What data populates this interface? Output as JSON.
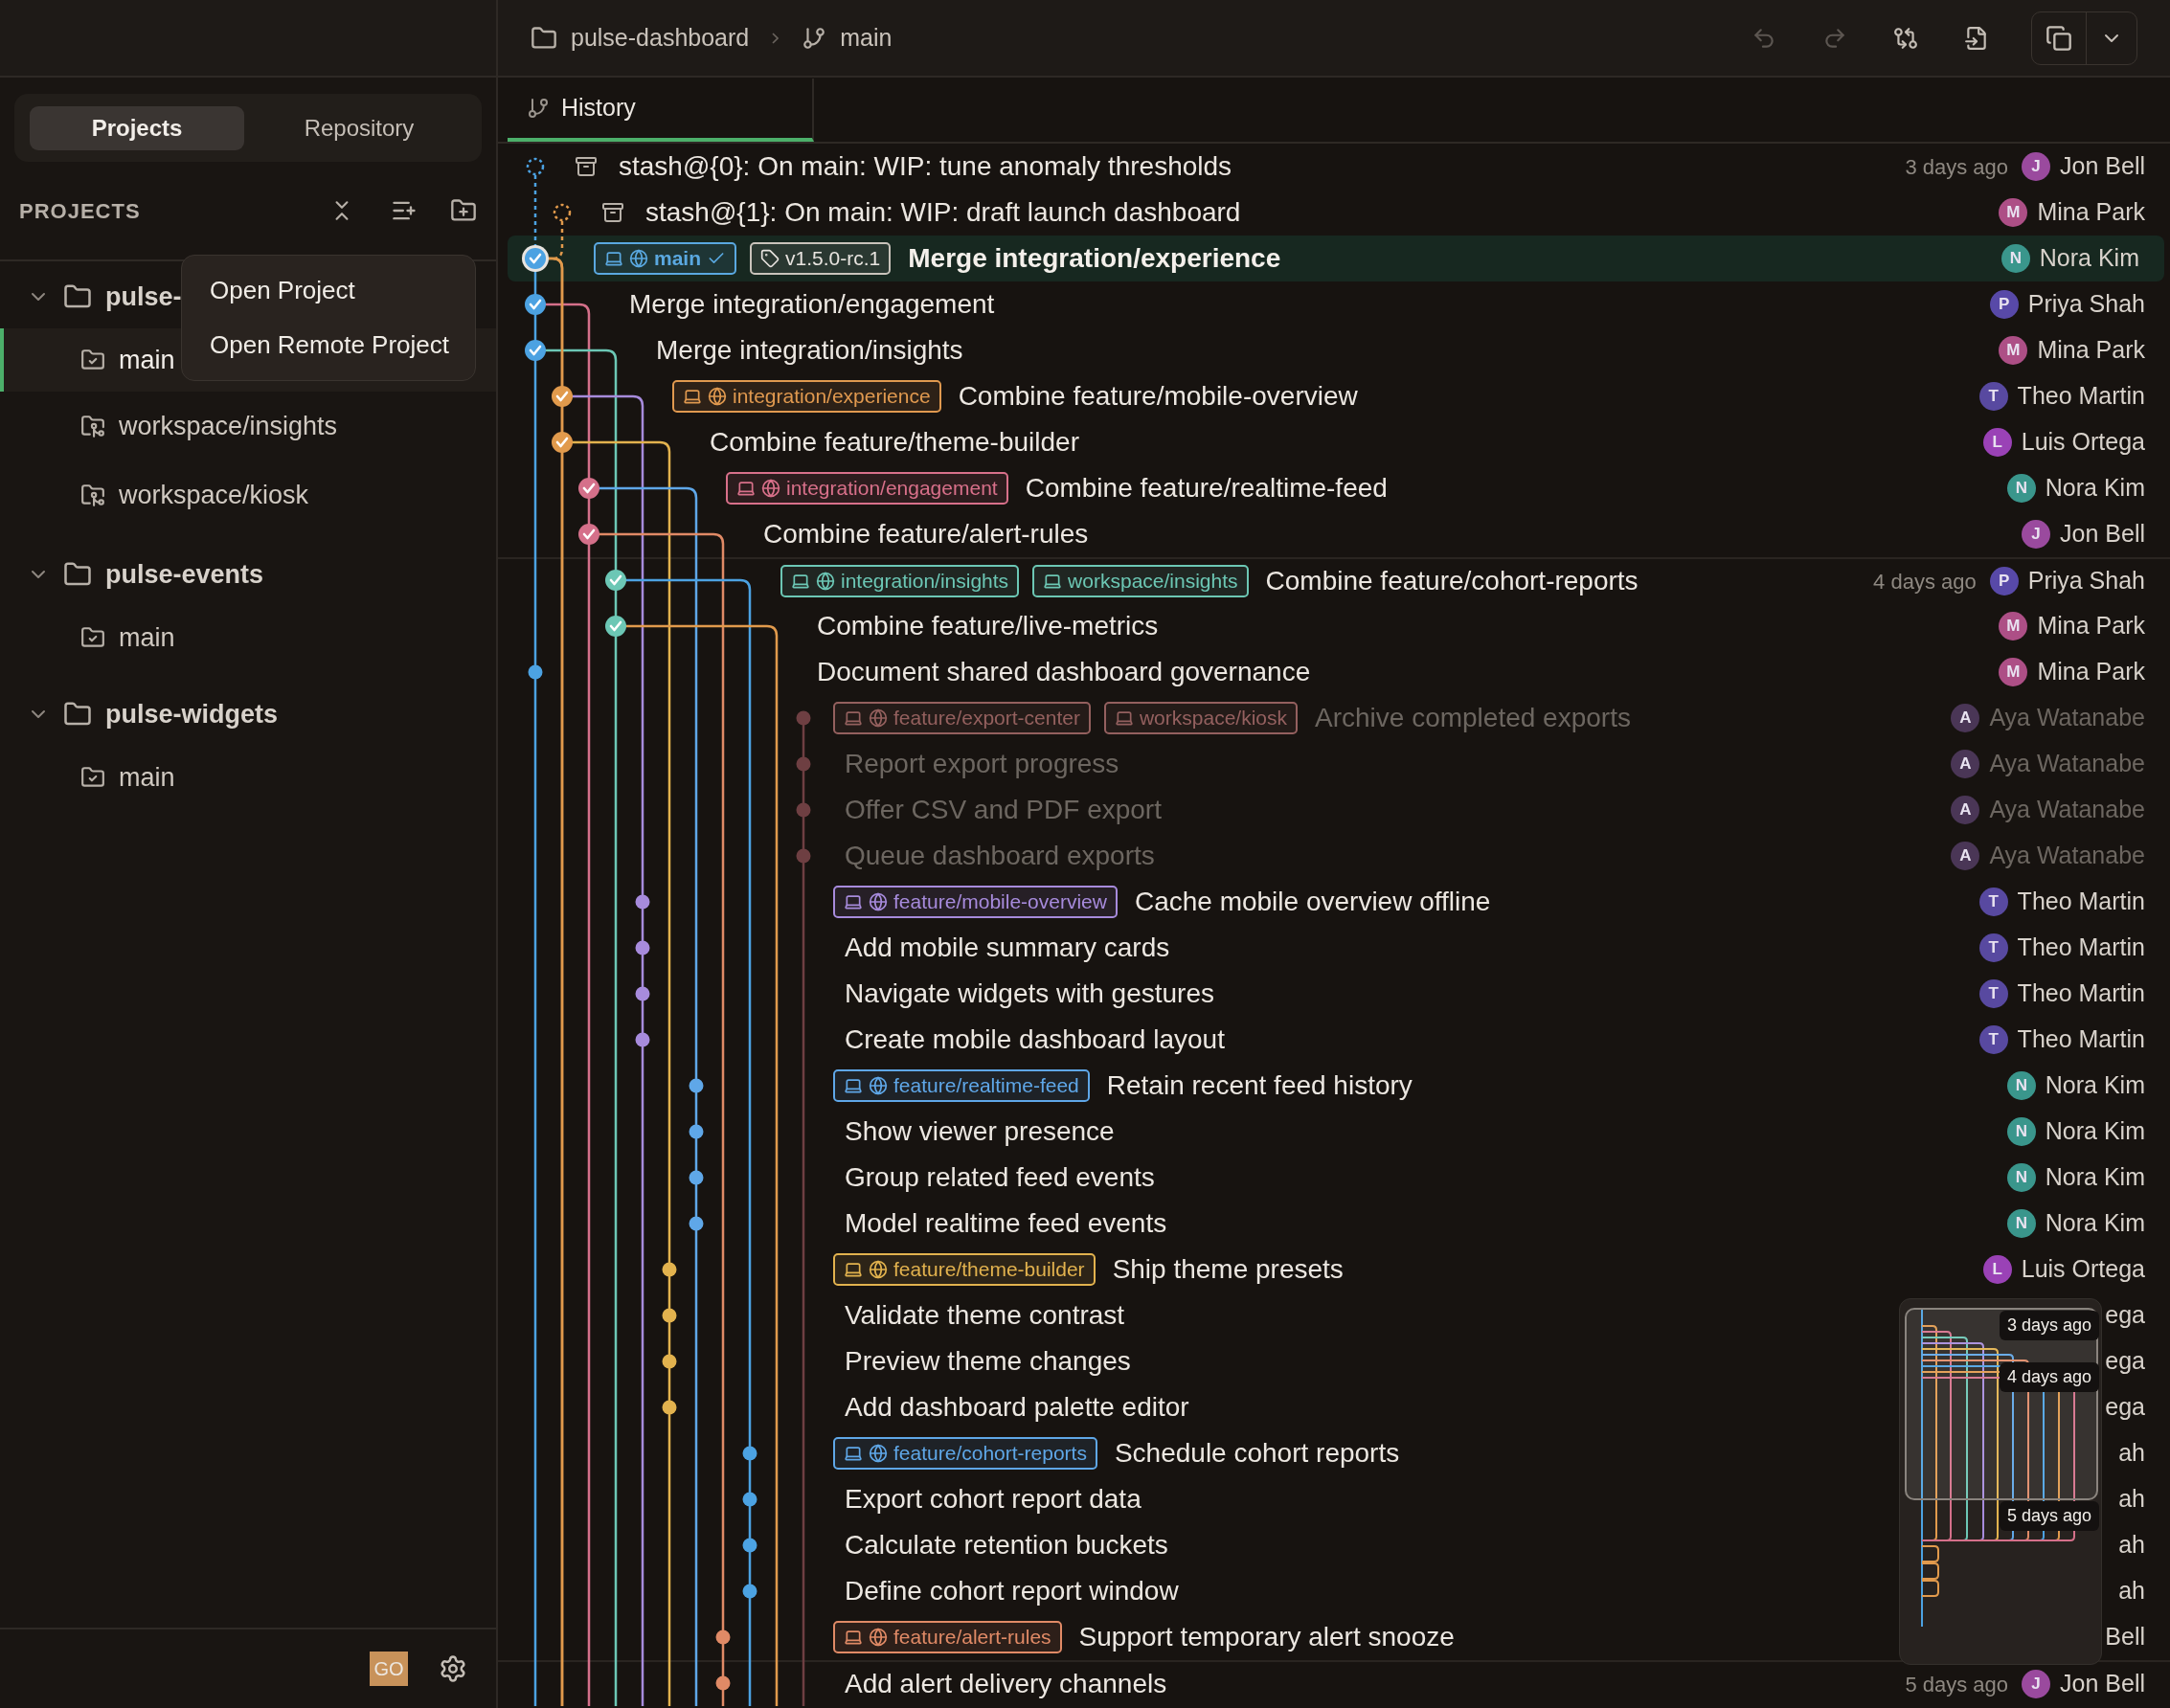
{
  "sidebar": {
    "tabs": [
      {
        "label": "Projects",
        "selected": true
      },
      {
        "label": "Repository",
        "selected": false
      }
    ],
    "section_title": "PROJECTS",
    "projects": [
      {
        "name": "pulse-",
        "expanded": true,
        "children": [
          {
            "name": "main",
            "kind": "branch",
            "selected": true
          },
          {
            "name": "workspace/insights",
            "kind": "workspace",
            "selected": false
          },
          {
            "name": "workspace/kiosk",
            "kind": "workspace",
            "selected": false
          }
        ]
      },
      {
        "name": "pulse-events",
        "expanded": true,
        "children": [
          {
            "name": "main",
            "kind": "branch",
            "selected": false
          }
        ]
      },
      {
        "name": "pulse-widgets",
        "expanded": true,
        "children": [
          {
            "name": "main",
            "kind": "branch",
            "selected": false
          }
        ]
      }
    ],
    "context_menu": [
      "Open Project",
      "Open Remote Project"
    ],
    "user": {
      "initials": "GO",
      "color": "#c8925a"
    }
  },
  "toolbar": {
    "project": "pulse-dashboard",
    "branch": "main"
  },
  "tabs": [
    {
      "label": "History",
      "selected": true
    }
  ],
  "history": [
    {
      "kind": "stash",
      "message": "stash@{0}: On main: WIP: tune anomaly thresholds",
      "time": "3 days ago",
      "author": {
        "name": "Jon Bell",
        "initial": "J",
        "color": "#9a4a9e"
      },
      "selected": false,
      "dimmed": false
    },
    {
      "kind": "stash",
      "message": "stash@{1}: On main: WIP: draft launch dashboard",
      "author": {
        "name": "Mina Park",
        "initial": "M",
        "color": "#ad4f86"
      },
      "selected": false,
      "dimmed": false
    },
    {
      "kind": "commit",
      "refs": [
        {
          "label": "main",
          "kind": "branch",
          "local": true,
          "remote": true,
          "current": true,
          "color": "#5aa8e0"
        },
        {
          "label": "v1.5.0-rc.1",
          "kind": "tag",
          "color": "#c9c3bb"
        }
      ],
      "message": "Merge integration/experience",
      "author": {
        "name": "Nora Kim",
        "initial": "N",
        "color": "#3a968c"
      },
      "selected": true,
      "dimmed": false
    },
    {
      "kind": "commit",
      "message": "Merge integration/engagement",
      "author": {
        "name": "Priya Shah",
        "initial": "P",
        "color": "#5849a8"
      },
      "selected": false,
      "dimmed": false
    },
    {
      "kind": "commit",
      "message": "Merge integration/insights",
      "author": {
        "name": "Mina Park",
        "initial": "M",
        "color": "#ad4f86"
      },
      "selected": false,
      "dimmed": false
    },
    {
      "kind": "commit",
      "refs": [
        {
          "label": "integration/experience",
          "kind": "branch",
          "local": true,
          "remote": true,
          "current": false,
          "color": "#e0994f"
        }
      ],
      "message": "Combine feature/mobile-overview",
      "author": {
        "name": "Theo Martin",
        "initial": "T",
        "color": "#5849a0"
      },
      "selected": false,
      "dimmed": false
    },
    {
      "kind": "commit",
      "message": "Combine feature/theme-builder",
      "author": {
        "name": "Luis Ortega",
        "initial": "L",
        "color": "#9a42b6"
      },
      "selected": false,
      "dimmed": false
    },
    {
      "kind": "commit",
      "refs": [
        {
          "label": "integration/engagement",
          "kind": "branch",
          "local": true,
          "remote": true,
          "current": false,
          "color": "#d8708a"
        }
      ],
      "message": "Combine feature/realtime-feed",
      "author": {
        "name": "Nora Kim",
        "initial": "N",
        "color": "#3a968c"
      },
      "selected": false,
      "dimmed": false
    },
    {
      "kind": "commit",
      "message": "Combine feature/alert-rules",
      "author": {
        "name": "Jon Bell",
        "initial": "J",
        "color": "#9a4a9e"
      },
      "selected": false,
      "dimmed": false
    },
    {
      "kind": "commit",
      "refs": [
        {
          "label": "integration/insights",
          "kind": "branch",
          "local": true,
          "remote": true,
          "current": false,
          "color": "#6cc7b5"
        },
        {
          "label": "workspace/insights",
          "kind": "branch",
          "local": true,
          "remote": false,
          "current": false,
          "color": "#6cc7b4"
        }
      ],
      "message": "Combine feature/cohort-reports",
      "time": "4 days ago",
      "author": {
        "name": "Priya Shah",
        "initial": "P",
        "color": "#5849a8"
      },
      "selected": false,
      "dimmed": false
    },
    {
      "kind": "commit",
      "message": "Combine feature/live-metrics",
      "author": {
        "name": "Mina Park",
        "initial": "M",
        "color": "#ad4f86"
      },
      "selected": false,
      "dimmed": false
    },
    {
      "kind": "commit",
      "message": "Document shared dashboard governance",
      "author": {
        "name": "Mina Park",
        "initial": "M",
        "color": "#ad4f86"
      },
      "selected": false,
      "dimmed": false
    },
    {
      "kind": "commit",
      "refs": [
        {
          "label": "feature/export-center",
          "kind": "branch",
          "local": true,
          "remote": true,
          "current": false,
          "color": "#94605e"
        },
        {
          "label": "workspace/kiosk",
          "kind": "branch",
          "local": true,
          "remote": false,
          "current": false,
          "color": "#94605f"
        }
      ],
      "message": "Archive completed exports",
      "author": {
        "name": "Aya Watanabe",
        "initial": "A",
        "color": "#4a3656"
      },
      "selected": false,
      "dimmed": true
    },
    {
      "kind": "commit",
      "message": "Report export progress",
      "author": {
        "name": "Aya Watanabe",
        "initial": "A",
        "color": "#4a3656"
      },
      "selected": false,
      "dimmed": true
    },
    {
      "kind": "commit",
      "message": "Offer CSV and PDF export",
      "author": {
        "name": "Aya Watanabe",
        "initial": "A",
        "color": "#4a3656"
      },
      "selected": false,
      "dimmed": true
    },
    {
      "kind": "commit",
      "message": "Queue dashboard exports",
      "author": {
        "name": "Aya Watanabe",
        "initial": "A",
        "color": "#4a3656"
      },
      "selected": false,
      "dimmed": true
    },
    {
      "kind": "commit",
      "refs": [
        {
          "label": "feature/mobile-overview",
          "kind": "branch",
          "local": true,
          "remote": true,
          "current": false,
          "color": "#a78bdc"
        }
      ],
      "message": "Cache mobile overview offline",
      "author": {
        "name": "Theo Martin",
        "initial": "T",
        "color": "#5849a0"
      },
      "selected": false,
      "dimmed": false
    },
    {
      "kind": "commit",
      "message": "Add mobile summary cards",
      "author": {
        "name": "Theo Martin",
        "initial": "T",
        "color": "#5849a0"
      },
      "selected": false,
      "dimmed": false
    },
    {
      "kind": "commit",
      "message": "Navigate widgets with gestures",
      "author": {
        "name": "Theo Martin",
        "initial": "T",
        "color": "#5849a0"
      },
      "selected": false,
      "dimmed": false
    },
    {
      "kind": "commit",
      "message": "Create mobile dashboard layout",
      "author": {
        "name": "Theo Martin",
        "initial": "T",
        "color": "#5849a0"
      },
      "selected": false,
      "dimmed": false
    },
    {
      "kind": "commit",
      "refs": [
        {
          "label": "feature/realtime-feed",
          "kind": "branch",
          "local": true,
          "remote": true,
          "current": false,
          "color": "#5fa7e8"
        }
      ],
      "message": "Retain recent feed history",
      "author": {
        "name": "Nora Kim",
        "initial": "N",
        "color": "#3a968c"
      },
      "selected": false,
      "dimmed": false
    },
    {
      "kind": "commit",
      "message": "Show viewer presence",
      "author": {
        "name": "Nora Kim",
        "initial": "N",
        "color": "#3a968c"
      },
      "selected": false,
      "dimmed": false
    },
    {
      "kind": "commit",
      "message": "Group related feed events",
      "author": {
        "name": "Nora Kim",
        "initial": "N",
        "color": "#3a968c"
      },
      "selected": false,
      "dimmed": false
    },
    {
      "kind": "commit",
      "message": "Model realtime feed events",
      "author": {
        "name": "Nora Kim",
        "initial": "N",
        "color": "#3a968c"
      },
      "selected": false,
      "dimmed": false
    },
    {
      "kind": "commit",
      "refs": [
        {
          "label": "feature/theme-builder",
          "kind": "branch",
          "local": true,
          "remote": true,
          "current": false,
          "color": "#e2b24e"
        }
      ],
      "message": "Ship theme presets",
      "author": {
        "name": "Luis Ortega",
        "initial": "L",
        "color": "#9a42b6"
      },
      "selected": false,
      "dimmed": false
    },
    {
      "kind": "commit",
      "message": "Validate theme contrast",
      "author": {
        "name": "ega"
      },
      "selected": false,
      "dimmed": false
    },
    {
      "kind": "commit",
      "message": "Preview theme changes",
      "author": {
        "name": "ega"
      },
      "selected": false,
      "dimmed": false
    },
    {
      "kind": "commit",
      "message": "Add dashboard palette editor",
      "author": {
        "name": "ega"
      },
      "selected": false,
      "dimmed": false
    },
    {
      "kind": "commit",
      "refs": [
        {
          "label": "feature/cohort-reports",
          "kind": "branch",
          "local": true,
          "remote": true,
          "current": false,
          "color": "#5fa7e7"
        }
      ],
      "message": "Schedule cohort reports",
      "author": {
        "name": "ah"
      },
      "selected": false,
      "dimmed": false
    },
    {
      "kind": "commit",
      "message": "Export cohort report data",
      "author": {
        "name": "ah"
      },
      "selected": false,
      "dimmed": false
    },
    {
      "kind": "commit",
      "message": "Calculate retention buckets",
      "author": {
        "name": "ah"
      },
      "selected": false,
      "dimmed": false
    },
    {
      "kind": "commit",
      "message": "Define cohort report window",
      "author": {
        "name": "ah"
      },
      "selected": false,
      "dimmed": false
    },
    {
      "kind": "commit",
      "refs": [
        {
          "label": "feature/alert-rules",
          "kind": "branch",
          "local": true,
          "remote": true,
          "current": false,
          "color": "#e08a66"
        }
      ],
      "message": "Support temporary alert snooze",
      "author": {
        "name": "Bell"
      },
      "selected": false,
      "dimmed": false
    },
    {
      "kind": "commit",
      "message": "Add alert delivery channels",
      "time": "5 days ago",
      "author": {
        "name": "Jon Bell",
        "initial": "J",
        "color": "#9a4a9e"
      },
      "selected": false,
      "dimmed": false
    }
  ],
  "minimap": {
    "labels": [
      "3 days ago",
      "4 days ago",
      "5 days ago"
    ]
  }
}
